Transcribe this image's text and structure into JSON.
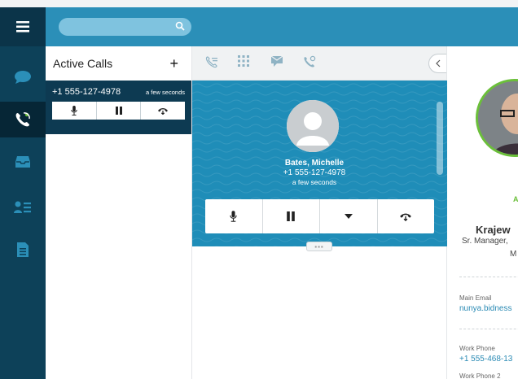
{
  "colors": {
    "rail_bg": "#0d4159",
    "topbar_bg": "#2b8fb8",
    "call_area_bg": "#1f8db8",
    "active_card_bg": "#0d3a52",
    "status_green": "#6bbf3a",
    "link_blue": "#2a8ab4"
  },
  "rail": {
    "menu_icon": "hamburger-icon",
    "items": [
      {
        "icon": "chat-bubble-icon",
        "active": false
      },
      {
        "icon": "phone-call-icon",
        "active": true
      },
      {
        "icon": "inbox-tray-icon",
        "active": false
      },
      {
        "icon": "contact-list-icon",
        "active": false
      },
      {
        "icon": "document-icon",
        "active": false
      }
    ]
  },
  "search": {
    "placeholder": "",
    "icon": "search-icon"
  },
  "active_calls": {
    "title": "Active Calls",
    "add_label": "+",
    "call": {
      "number": "+1 555-127-4978",
      "time": "a few seconds",
      "controls": [
        "mute-icon",
        "pause-icon",
        "hangup-icon"
      ]
    }
  },
  "center": {
    "toolbar_icons": [
      "call-log-icon",
      "dialpad-icon",
      "message-icon",
      "call-settings-icon"
    ],
    "caller": {
      "name": "Bates, Michelle",
      "number": "+1 555-127-4978",
      "time": "a few seconds"
    },
    "controls": [
      "mute-icon",
      "pause-icon",
      "dropdown-icon",
      "hangup-icon"
    ],
    "grip_label": "▪▪▪"
  },
  "contact": {
    "status": "A",
    "name": "Krajew",
    "title_line1": "Sr. Manager,",
    "title_line2": "M",
    "main_email_label": "Main Email",
    "main_email": "nunya.bidness",
    "work_phone_label": "Work Phone",
    "work_phone": "+1 555-468-13",
    "work_phone2_label": "Work Phone 2"
  }
}
